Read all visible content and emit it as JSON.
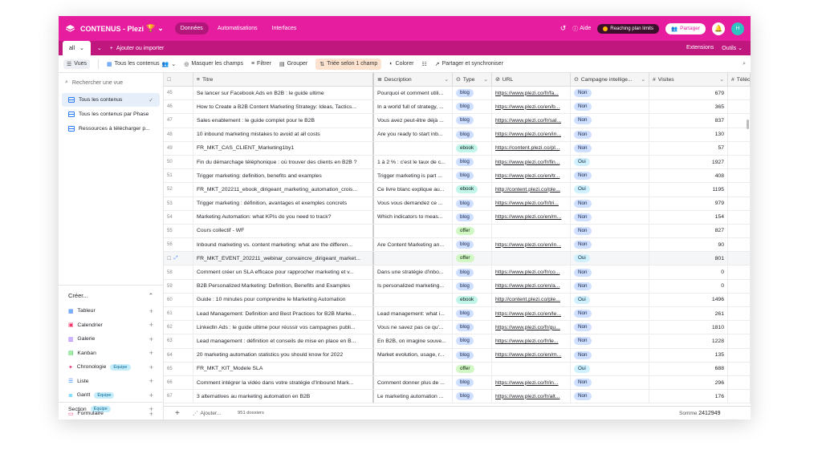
{
  "header": {
    "base_name": "CONTENUS - Plezi",
    "nav": [
      "Données",
      "Automatisations",
      "Interfaces"
    ],
    "help": "Aide",
    "plan_limit": "Reaching plan limits",
    "share": "Partager",
    "avatar_initial": "H",
    "brand_color": "#e61d9e"
  },
  "tabs": {
    "current_tab": "all",
    "add_import": "Ajouter ou importer",
    "extensions": "Extensions",
    "outils": "Outils"
  },
  "toolbar": {
    "vues": "Vues",
    "view_name": "Tous les contenus",
    "hide_fields": "Masquer les champs",
    "filter": "Filtrer",
    "group": "Grouper",
    "sorted": "Triée selon 1 champ",
    "color": "Colorer",
    "share_sync": "Partager et synchroniser"
  },
  "sidebar": {
    "search_placeholder": "Rechercher une vue",
    "views": [
      "Tous les contenus",
      "Tous les contenus par Phase",
      "Ressources à télécharger p..."
    ],
    "create_title": "Créer...",
    "create_items": [
      {
        "label": "Tableur",
        "badge": "",
        "icon": "grid-icon"
      },
      {
        "label": "Calendrier",
        "badge": "",
        "icon": "calendar-icon"
      },
      {
        "label": "Galerie",
        "badge": "",
        "icon": "gallery-icon"
      },
      {
        "label": "Kanban",
        "badge": "",
        "icon": "kanban-icon"
      },
      {
        "label": "Chronologie",
        "badge": "Équipe",
        "icon": "timeline-icon"
      },
      {
        "label": "Liste",
        "badge": "",
        "icon": "list-icon"
      },
      {
        "label": "Gantt",
        "badge": "Équipe",
        "icon": "gantt-icon"
      }
    ],
    "section": {
      "label": "Section",
      "badge": "Équipe"
    },
    "form": "Formulaire"
  },
  "grid": {
    "columns": [
      "Titre",
      "Description",
      "Type",
      "URL",
      "Campagne intellige...",
      "Visites",
      "Téléc"
    ],
    "rows": [
      {
        "n": "45",
        "titre": "Se lancer sur Facebook Ads en B2B : le guide ultime",
        "desc": "Pourquoi et comment utili...",
        "type": "blog",
        "url": "https://www.plezi.co/fr/fa...",
        "camp": "Non",
        "vis": "679"
      },
      {
        "n": "46",
        "titre": "How to Create a B2B Content Marketing Strategy: Ideas, Tactics...",
        "desc": "In a world full of strategy, ...",
        "type": "blog",
        "url": "https://www.plezi.co/en/b...",
        "camp": "Non",
        "vis": "365"
      },
      {
        "n": "47",
        "titre": "Sales enablement : le guide complet pour le B2B",
        "desc": "Vous avez peut-être déjà ...",
        "type": "blog",
        "url": "https://www.plezi.co/fr/sal...",
        "camp": "Non",
        "vis": "837"
      },
      {
        "n": "48",
        "titre": "10 inbound marketing mistakes to avoid at all costs",
        "desc": "Are you ready to start inb...",
        "type": "blog",
        "url": "https://www.plezi.co/en/in...",
        "camp": "Non",
        "vis": "130"
      },
      {
        "n": "49",
        "titre": "FR_MKT_CAS_CLIENT_Marketing1by1",
        "desc": "",
        "type": "ebook",
        "url": "https://content.plezi.co/pl...",
        "camp": "Non",
        "vis": "57"
      },
      {
        "n": "50",
        "titre": "Fin du démarchage téléphonique : où trouver des clients en B2B ?",
        "desc": "1 à 2 % : c'est le taux de c...",
        "type": "blog",
        "url": "https://www.plezi.co/fr/fin...",
        "camp": "Oui",
        "vis": "1927"
      },
      {
        "n": "51",
        "titre": "Trigger marketing: definition, benefits and examples",
        "desc": "Trigger marketing is part ...",
        "type": "blog",
        "url": "https://www.plezi.co/en/tr...",
        "camp": "Non",
        "vis": "408"
      },
      {
        "n": "52",
        "titre": "FR_MKT_202211_ebook_dirigeant_marketing_automation_crois...",
        "desc": "Ce livre blanc explique au...",
        "type": "ebook",
        "url": "http://content.plezi.co/ple...",
        "camp": "Oui",
        "vis": "1195"
      },
      {
        "n": "53",
        "titre": "Trigger marketing : définition, avantages et exemples concrets",
        "desc": "Vous vous demandez ce ...",
        "type": "blog",
        "url": "https://www.plezi.co/fr/tri...",
        "camp": "Non",
        "vis": "979"
      },
      {
        "n": "54",
        "titre": "Marketing Automation: what KPIs do you need to track?",
        "desc": "Which indicators to meas...",
        "type": "blog",
        "url": "https://www.plezi.co/en/m...",
        "camp": "Non",
        "vis": "154"
      },
      {
        "n": "55",
        "titre": "Cours collectif - WF",
        "desc": "",
        "type": "offer",
        "url": "",
        "camp": "Non",
        "vis": "827"
      },
      {
        "n": "56",
        "titre": "Inbound marketing vs. content marketing: what are the differen...",
        "desc": "Are Content Marketing an...",
        "type": "blog",
        "url": "https://www.plezi.co/en/in...",
        "camp": "Non",
        "vis": "90"
      },
      {
        "n": "",
        "titre": "FR_MKT_EVENT_202211_webinar_convaincre_dirigeant_market...",
        "desc": "",
        "type": "offer",
        "url": "",
        "camp": "Oui",
        "vis": "801"
      },
      {
        "n": "58",
        "titre": "Comment créer un SLA efficace pour rapprocher marketing et v...",
        "desc": "Dans une stratégie d'inbo...",
        "type": "blog",
        "url": "https://www.plezi.co/fr/co...",
        "camp": "Non",
        "vis": "0"
      },
      {
        "n": "59",
        "titre": "B2B Personalized Marketing: Definition, Benefits and Examples",
        "desc": "Is personalized marketing...",
        "type": "blog",
        "url": "https://www.plezi.co/en/a...",
        "camp": "Non",
        "vis": "0"
      },
      {
        "n": "60",
        "titre": "Guide : 10 minutes pour comprendre le Marketing Automation",
        "desc": "",
        "type": "ebook",
        "url": "http://content.plezi.co/ple...",
        "camp": "Oui",
        "vis": "1496"
      },
      {
        "n": "61",
        "titre": "Lead Management: Definition and Best Practices for B2B Marke...",
        "desc": "Lead management: what i...",
        "type": "blog",
        "url": "https://www.plezi.co/en/le...",
        "camp": "Non",
        "vis": "261"
      },
      {
        "n": "62",
        "titre": "LinkedIn Ads : le guide ultime pour réussir vos campagnes publi...",
        "desc": "Vous ne savez pas ce qu'...",
        "type": "blog",
        "url": "https://www.plezi.co/fr/gu...",
        "camp": "Non",
        "vis": "1810"
      },
      {
        "n": "63",
        "titre": "Lead management : définition et conseils de mise en place en B...",
        "desc": "En B2B, on imagine souve...",
        "type": "blog",
        "url": "https://www.plezi.co/fr/le...",
        "camp": "Non",
        "vis": "1228"
      },
      {
        "n": "64",
        "titre": "20 marketing automation statistics you should know for 2022",
        "desc": "Market evolution, usage, r...",
        "type": "blog",
        "url": "https://www.plezi.co/en/m...",
        "camp": "Non",
        "vis": "135"
      },
      {
        "n": "65",
        "titre": "FR_MKT_KIT_Modele SLA",
        "desc": "",
        "type": "offer",
        "url": "",
        "camp": "Oui",
        "vis": "688"
      },
      {
        "n": "66",
        "titre": "Comment intégrer la vidéo dans votre stratégie d'Inbound Mark...",
        "desc": "Comment donner plus de ...",
        "type": "blog",
        "url": "https://www.plezi.co/fr/in...",
        "camp": "Non",
        "vis": "296"
      },
      {
        "n": "67",
        "titre": "3 alternatives au marketing automation en B2B",
        "desc": "Le marketing automation ...",
        "type": "blog",
        "url": "https://www.plezi.co/fr/alt...",
        "camp": "Non",
        "vis": "176"
      }
    ],
    "footer": {
      "add": "Ajouter...",
      "count": "951 dossiers",
      "sum_label": "Somme",
      "sum_value": "2412949"
    }
  }
}
